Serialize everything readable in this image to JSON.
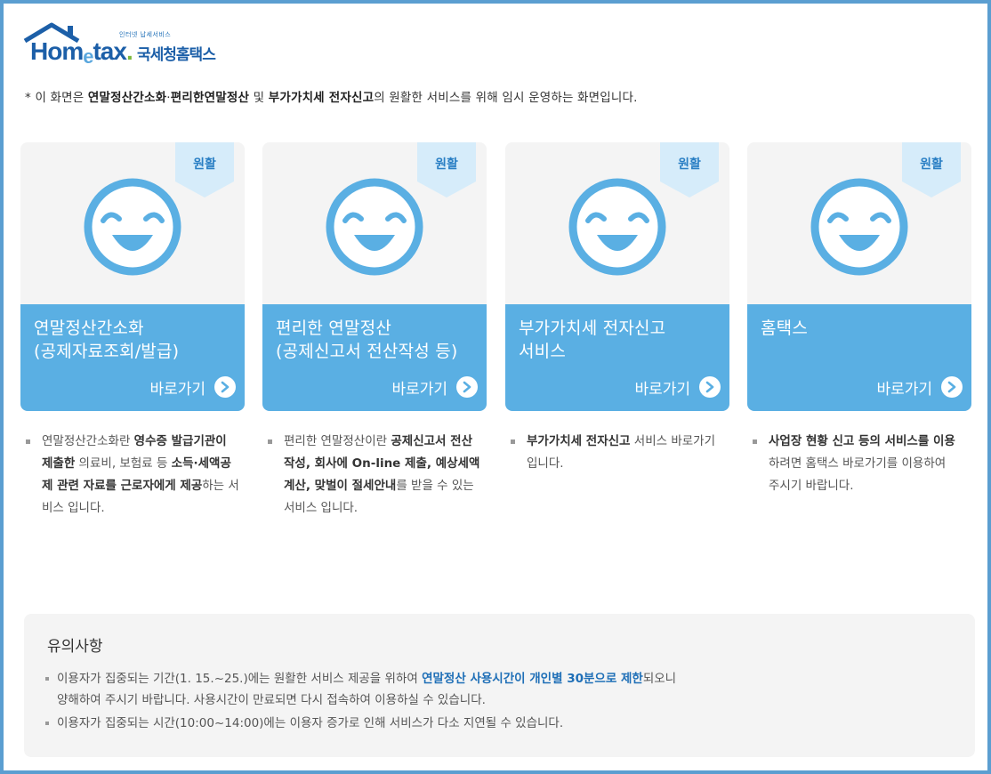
{
  "logo": {
    "sub": "인터넷 납세서비스",
    "home": "Hom",
    "e": "e",
    "tax": "tax",
    "dot": ".",
    "name": "국세청홈택스"
  },
  "notice": {
    "prefix": "* 이 화면은 ",
    "bold1": "연말정산간소화",
    "mid1": "·",
    "bold2": "편리한연말정산",
    "mid2": " 및 ",
    "bold3": "부가가치세 전자신고",
    "suffix": "의 원활한 서비스를 위해 임시 운영하는 화면입니다."
  },
  "cards": [
    {
      "status": "원활",
      "title": "연말정산간소화\n(공제자료조회/발급)",
      "link": "바로가기",
      "desc": [
        {
          "t": "연말정산간소화란 "
        },
        {
          "b": "영수증 발급기관이 제출한"
        },
        {
          "t": " 의료비, 보험료 등 "
        },
        {
          "b": "소득·세액공제 관련 자료를 근로자에게 제공"
        },
        {
          "t": "하는 서비스 입니다."
        }
      ]
    },
    {
      "status": "원활",
      "title": "편리한 연말정산\n(공제신고서 전산작성 등)",
      "link": "바로가기",
      "desc": [
        {
          "t": "편리한 연말정산이란 "
        },
        {
          "b": "공제신고서 전산작성, 회사에 On-line 제출, 예상세액 계산, 맞벌이 절세안내"
        },
        {
          "t": "를 받을 수 있는 서비스 입니다."
        }
      ]
    },
    {
      "status": "원활",
      "title": "부가가치세 전자신고\n서비스",
      "link": "바로가기",
      "desc": [
        {
          "b": "부가가치세 전자신고"
        },
        {
          "t": " 서비스 바로가기 입니다."
        }
      ]
    },
    {
      "status": "원활",
      "title": "홈택스",
      "link": "바로가기",
      "desc": [
        {
          "b": "사업장 현황 신고 등의 서비스를 이용"
        },
        {
          "t": "하려면 홈택스 바로가기를 이용하여 주시기 바랍니다."
        }
      ]
    }
  ],
  "caution": {
    "title": "유의사항",
    "item1_a": "이용자가 집중되는 기간(1. 15.~25.)에는 원활한 서비스 제공을 위하여 ",
    "item1_b": "연말정산 사용시간이 개인별 30분으로 제한",
    "item1_c": "되오니",
    "item1_d": "양해하여 주시기 바랍니다. 사용시간이 만료되면 다시 접속하여 이용하실 수 있습니다.",
    "item2": "이용자가 집중되는 시간(10:00~14:00)에는 이용자 증가로 인해 서비스가 다소 지연될 수 있습니다."
  },
  "colors": {
    "frame": "#5b9ed1",
    "card_blue": "#5aafe3",
    "ribbon": "#d6ecfa",
    "smiley": "#5aafe3",
    "emphasis": "#1f6fb7"
  }
}
